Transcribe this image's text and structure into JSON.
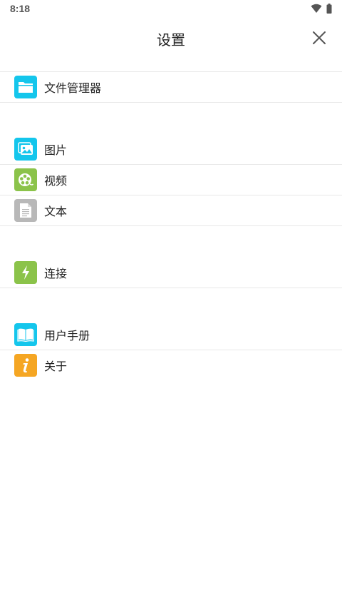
{
  "status": {
    "time": "8:18"
  },
  "header": {
    "title": "设置"
  },
  "sections": [
    {
      "items": [
        {
          "label": "文件管理器",
          "icon": "folder-icon",
          "color": "#14c6ec"
        }
      ]
    },
    {
      "items": [
        {
          "label": "图片",
          "icon": "image-icon",
          "color": "#14c6ec"
        },
        {
          "label": "视频",
          "icon": "film-reel-icon",
          "color": "#8bc34a"
        },
        {
          "label": "文本",
          "icon": "document-icon",
          "color": "#b8b8b8"
        }
      ]
    },
    {
      "items": [
        {
          "label": "连接",
          "icon": "lightning-icon",
          "color": "#8bc34a"
        }
      ]
    },
    {
      "items": [
        {
          "label": "用户手册",
          "icon": "book-icon",
          "color": "#14c6ec"
        },
        {
          "label": "关于",
          "icon": "info-icon",
          "color": "#f5a623"
        }
      ]
    }
  ]
}
